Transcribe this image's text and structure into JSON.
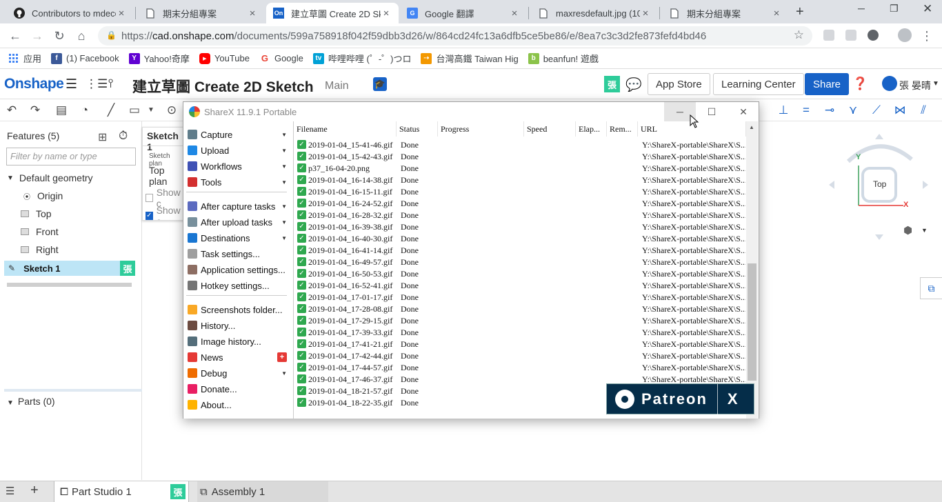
{
  "browser": {
    "tabs": [
      {
        "title": "Contributors to mdecou",
        "favicon": "github-icon"
      },
      {
        "title": "期末分組專案",
        "favicon": "page-icon"
      },
      {
        "title": "建立草圖 Create 2D Sk",
        "favicon": "onshape-icon"
      },
      {
        "title": "Google 翻譯",
        "favicon": "google-translate-icon"
      },
      {
        "title": "maxresdefault.jpg (10",
        "favicon": "page-icon"
      },
      {
        "title": "期末分組專案",
        "favicon": "page-icon"
      }
    ],
    "url_scheme": "https://",
    "url_host": "cad.onshape.com",
    "url_path": "/documents/599a758918f042f59dbb3d26/w/864cd24fc13a6dfb5ce5be86/e/8ea7c3c3d2fe873fefd4bd46",
    "bookmarks": [
      {
        "label": "应用",
        "color": "#4285f4"
      },
      {
        "label": "(1) Facebook",
        "color": "#3b5998"
      },
      {
        "label": "Yahoo!奇摩",
        "color": "#6001d2"
      },
      {
        "label": "YouTube",
        "color": "#ff0000"
      },
      {
        "label": "Google",
        "color": "#ea4335"
      },
      {
        "label": "哔哩哔哩 (゜-゜)つロ",
        "color": "#00a1d6"
      },
      {
        "label": "台灣高鐵 Taiwan Hig",
        "color": "#f39800"
      },
      {
        "label": "beanfun! 遊戲",
        "color": "#8bc34a"
      }
    ]
  },
  "onshape": {
    "logo": "Onshape",
    "doc_title": "建立草圖 Create 2D Sketch",
    "workspace": "Main",
    "user_badge": "張",
    "app_store": "App Store",
    "learning_center": "Learning Center",
    "share": "Share",
    "user_name": "張 晏晴",
    "features_title": "Features (5)",
    "filter_placeholder": "Filter by name or type",
    "default_geometry": "Default geometry",
    "origin": "Origin",
    "top": "Top",
    "front": "Front",
    "right": "Right",
    "sketch": "Sketch 1",
    "parts": "Parts (0)",
    "sketch_panel": {
      "title": "Sketch 1",
      "plane_label": "Sketch plan",
      "plane_value": "Top plan",
      "show1": "Show c",
      "show2": "Show c"
    },
    "view_cube": {
      "label": "Top",
      "x": "X",
      "y": "Y"
    },
    "bottom_tabs": [
      "Part Studio 1",
      "Assembly 1"
    ]
  },
  "sharex": {
    "title": "ShareX 11.9.1 Portable",
    "menu": [
      {
        "label": "Capture",
        "icon": "camera-icon",
        "color": "#607d8b",
        "arrow": true
      },
      {
        "label": "Upload",
        "icon": "upload-arrow-icon",
        "color": "#1e88e5",
        "arrow": true
      },
      {
        "label": "Workflows",
        "icon": "workflow-grid-icon",
        "color": "#3f51b5",
        "arrow": true
      },
      {
        "label": "Tools",
        "icon": "toolbox-icon",
        "color": "#d32f2f",
        "arrow": true
      },
      {
        "label": "After capture tasks",
        "icon": "after-capture-icon",
        "color": "#5c6bc0",
        "arrow": true
      },
      {
        "label": "After upload tasks",
        "icon": "after-upload-icon",
        "color": "#78909c",
        "arrow": true
      },
      {
        "label": "Destinations",
        "icon": "globe-icon",
        "color": "#1976d2",
        "arrow": true
      },
      {
        "label": "Task settings...",
        "icon": "gear-icon",
        "color": "#9e9e9e",
        "arrow": false
      },
      {
        "label": "Application settings...",
        "icon": "wrench-icon",
        "color": "#8d6e63",
        "arrow": false
      },
      {
        "label": "Hotkey settings...",
        "icon": "keyboard-icon",
        "color": "#757575",
        "arrow": false
      },
      {
        "label": "Screenshots folder...",
        "icon": "folder-icon",
        "color": "#f9a825",
        "arrow": false
      },
      {
        "label": "History...",
        "icon": "history-icon",
        "color": "#6d4c41",
        "arrow": false
      },
      {
        "label": "Image history...",
        "icon": "image-history-icon",
        "color": "#546e7a",
        "arrow": false
      },
      {
        "label": "News",
        "icon": "megaphone-icon",
        "color": "#e53935",
        "arrow": false,
        "badge": "+"
      },
      {
        "label": "Debug",
        "icon": "traffic-cone-icon",
        "color": "#ef6c00",
        "arrow": true
      },
      {
        "label": "Donate...",
        "icon": "heart-icon",
        "color": "#e91e63",
        "arrow": false
      },
      {
        "label": "About...",
        "icon": "crown-icon",
        "color": "#ffb300",
        "arrow": false
      }
    ],
    "columns": [
      "Filename",
      "Status",
      "Progress",
      "Speed",
      "Elap...",
      "Rem...",
      "URL"
    ],
    "url_text": "Y:\\ShareX-portable\\ShareX\\S...",
    "rows": [
      {
        "file": "2019-01-04_15-41-46.gif",
        "status": "Done",
        "url": true
      },
      {
        "file": "2019-01-04_15-42-43.gif",
        "status": "Done",
        "url": true
      },
      {
        "file": "p37_16-04-20.png",
        "status": "Done",
        "url": true
      },
      {
        "file": "2019-01-04_16-14-38.gif",
        "status": "Done",
        "url": true
      },
      {
        "file": "2019-01-04_16-15-11.gif",
        "status": "Done",
        "url": true
      },
      {
        "file": "2019-01-04_16-24-52.gif",
        "status": "Done",
        "url": true
      },
      {
        "file": "2019-01-04_16-28-32.gif",
        "status": "Done",
        "url": true
      },
      {
        "file": "2019-01-04_16-39-38.gif",
        "status": "Done",
        "url": true
      },
      {
        "file": "2019-01-04_16-40-30.gif",
        "status": "Done",
        "url": true
      },
      {
        "file": "2019-01-04_16-41-14.gif",
        "status": "Done",
        "url": true
      },
      {
        "file": "2019-01-04_16-49-57.gif",
        "status": "Done",
        "url": true
      },
      {
        "file": "2019-01-04_16-50-53.gif",
        "status": "Done",
        "url": true
      },
      {
        "file": "2019-01-04_16-52-41.gif",
        "status": "Done",
        "url": true
      },
      {
        "file": "2019-01-04_17-01-17.gif",
        "status": "Done",
        "url": true
      },
      {
        "file": "2019-01-04_17-28-08.gif",
        "status": "Done",
        "url": true
      },
      {
        "file": "2019-01-04_17-29-15.gif",
        "status": "Done",
        "url": true
      },
      {
        "file": "2019-01-04_17-39-33.gif",
        "status": "Done",
        "url": true
      },
      {
        "file": "2019-01-04_17-41-21.gif",
        "status": "Done",
        "url": true
      },
      {
        "file": "2019-01-04_17-42-44.gif",
        "status": "Done",
        "url": true
      },
      {
        "file": "2019-01-04_17-44-57.gif",
        "status": "Done",
        "url": true
      },
      {
        "file": "2019-01-04_17-46-37.gif",
        "status": "Done",
        "url": true
      },
      {
        "file": "2019-01-04_18-21-57.gif",
        "status": "Done",
        "url": false
      },
      {
        "file": "2019-01-04_18-22-35.gif",
        "status": "Done",
        "url": false
      }
    ],
    "patreon_label": "Patreon",
    "patreon_close": "X"
  }
}
